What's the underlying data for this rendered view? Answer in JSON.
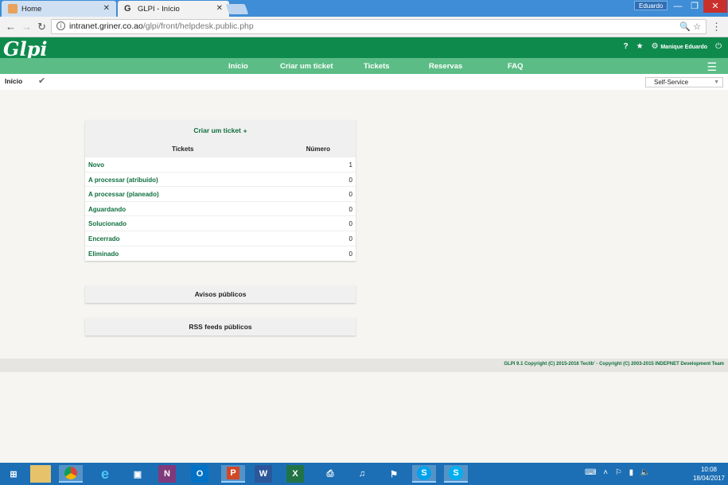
{
  "browser": {
    "tabs": [
      {
        "title": "Home",
        "active": false
      },
      {
        "title": "GLPI - Início",
        "active": true
      }
    ],
    "profile_name": "Eduardo",
    "url_host": "intranet.griner.co.ao",
    "url_path": "/glpi/front/helpdesk.public.php"
  },
  "header": {
    "logo": "Glpi",
    "user_label": "Manique Eduardo",
    "help_icon": "?",
    "colors": {
      "dark_green": "#0f8a4d",
      "light_green": "#5bbd85",
      "link_green": "#0f6f3d"
    }
  },
  "menu": {
    "items": [
      "Início",
      "Criar um ticket",
      "Tickets",
      "Reservas",
      "FAQ"
    ]
  },
  "breadcrumb": {
    "label": "Início",
    "profile_selected": "Self-Service"
  },
  "tickets_panel": {
    "create_label": "Criar um ticket",
    "col_tickets": "Tickets",
    "col_number": "Número",
    "rows": [
      {
        "label": "Novo",
        "count": "1"
      },
      {
        "label": "A processar (atribuído)",
        "count": "0"
      },
      {
        "label": "A processar (planeado)",
        "count": "0"
      },
      {
        "label": "Aguardando",
        "count": "0"
      },
      {
        "label": "Solucionado",
        "count": "0"
      },
      {
        "label": "Encerrado",
        "count": "0"
      },
      {
        "label": "Eliminado",
        "count": "0"
      }
    ]
  },
  "avisos": {
    "title": "Avisos públicos"
  },
  "rss": {
    "title": "RSS feeds públicos"
  },
  "footer": {
    "text": "GLPI 9.1 Copyright (C) 2015-2016 Teclib' - Copyright (C) 2003-2015 INDEPNET Development Team"
  },
  "taskbar": {
    "apps": [
      "start",
      "explorer",
      "chrome",
      "ie",
      "app",
      "onenote",
      "outlook",
      "powerpoint",
      "word",
      "excel",
      "printer",
      "itunes",
      "network",
      "skype-business",
      "skype"
    ],
    "time": "10:08",
    "date": "18/04/2017"
  }
}
